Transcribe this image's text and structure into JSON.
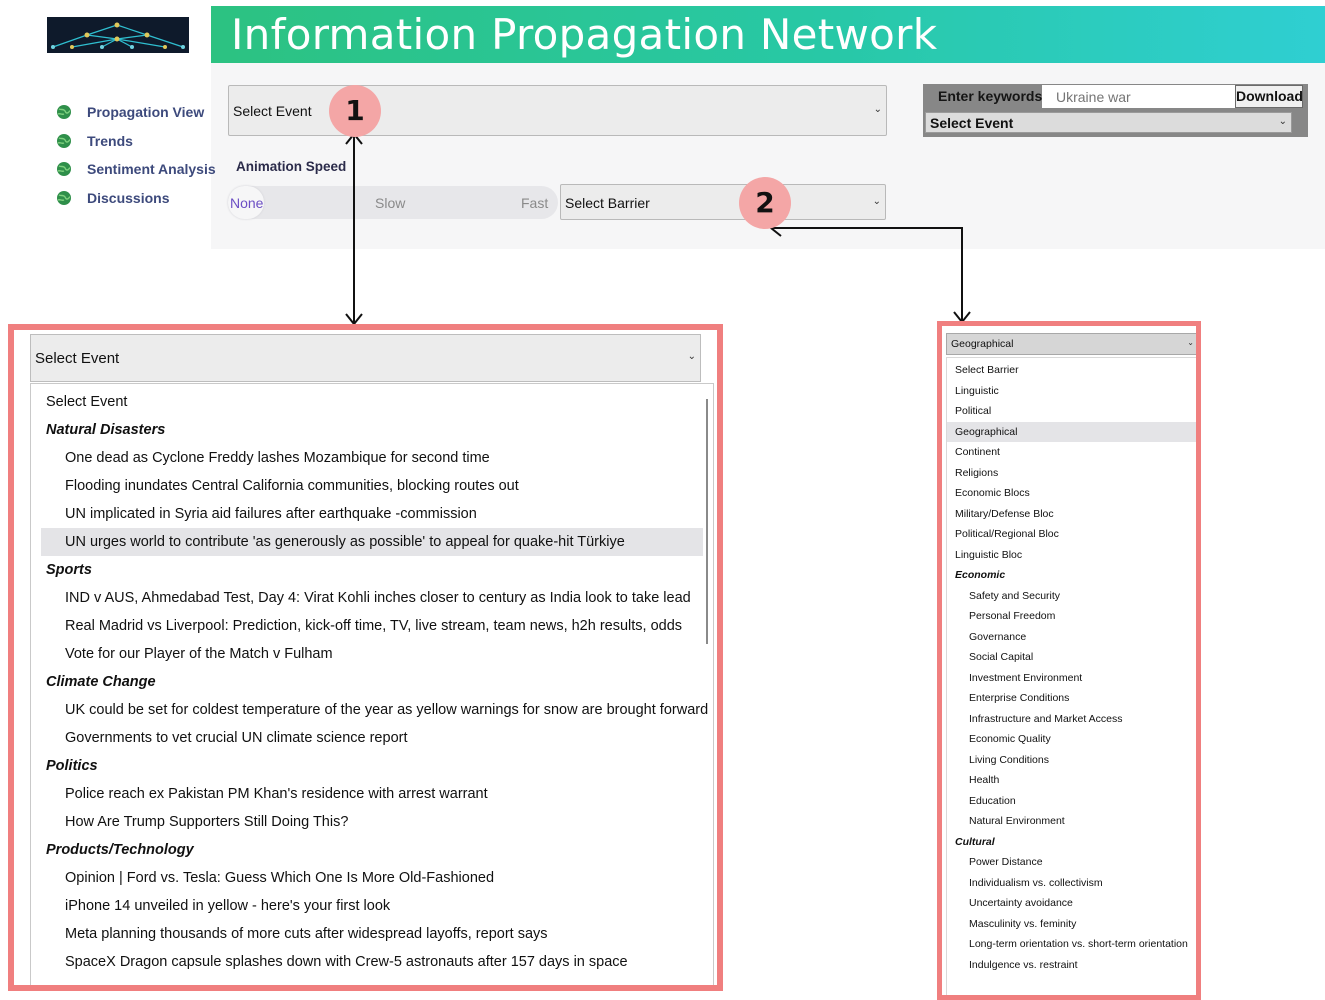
{
  "app": {
    "title": "Information Propagation Network",
    "brand_color": "#2cc281"
  },
  "sidebar": {
    "items": [
      {
        "label": "Propagation View",
        "icon": "globe-icon"
      },
      {
        "label": "Trends",
        "icon": "globe-icon"
      },
      {
        "label": "Sentiment Analysis",
        "icon": "globe-icon"
      },
      {
        "label": "Discussions",
        "icon": "globe-icon"
      }
    ]
  },
  "controls": {
    "event_select": {
      "value": "Select Event"
    },
    "animation_speed": {
      "label": "Animation Speed",
      "options": [
        "None",
        "Slow",
        "Fast"
      ],
      "selected": "None"
    },
    "barrier_select": {
      "value": "Select Barrier"
    }
  },
  "keywords_panel": {
    "label": "Enter keywords:",
    "input_placeholder": "Ukraine war",
    "download_label": "Download",
    "event_select_value": "Select Event"
  },
  "callouts": {
    "one": "1",
    "two": "2",
    "color": "#f4a6a6",
    "border_color": "#f07f7f"
  },
  "event_dropdown": {
    "selected": "Select Event",
    "default_option": "Select Event",
    "groups": [
      {
        "name": "Natural Disasters",
        "items": [
          "One dead as Cyclone Freddy lashes Mozambique for second time",
          "Flooding inundates Central California communities, blocking routes out",
          "UN implicated in Syria aid failures after earthquake -commission",
          "UN urges world to contribute 'as generously as possible' to appeal for quake-hit Türkiye"
        ]
      },
      {
        "name": "Sports",
        "items": [
          "IND v AUS, Ahmedabad Test, Day 4: Virat Kohli inches closer to century as India look to take lead",
          "Real Madrid vs Liverpool: Prediction, kick-off time, TV, live stream, team news, h2h results, odds",
          "Vote for our Player of the Match v Fulham"
        ]
      },
      {
        "name": "Climate Change",
        "items": [
          "UK could be set for coldest temperature of the year as yellow warnings for snow are brought forward",
          "Governments to vet crucial UN climate science report"
        ]
      },
      {
        "name": "Politics",
        "items": [
          "Police reach ex Pakistan PM Khan's residence with arrest warrant",
          "How Are Trump Supporters Still Doing This?"
        ]
      },
      {
        "name": "Products/Technology",
        "items": [
          "Opinion | Ford vs. Tesla: Guess Which One Is More Old-Fashioned",
          "iPhone 14 unveiled in yellow - here's your first look",
          "Meta planning thousands of more cuts after widespread layoffs, report says",
          "SpaceX Dragon capsule splashes down with Crew-5 astronauts after 157 days in space"
        ]
      }
    ],
    "highlighted": "UN urges world to contribute 'as generously as possible' to appeal for quake-hit Türkiye"
  },
  "barrier_dropdown": {
    "selected": "Geographical",
    "top_options": [
      "Select Barrier",
      "Linguistic",
      "Political",
      "Geographical",
      "Continent",
      "Religions",
      "Economic Blocs",
      "Military/Defense Bloc",
      "Political/Regional Bloc",
      "Linguistic Bloc"
    ],
    "highlighted": "Geographical",
    "groups": [
      {
        "name": "Economic",
        "items": [
          "Safety and Security",
          "Personal Freedom",
          "Governance",
          "Social Capital",
          "Investment Environment",
          "Enterprise Conditions",
          "Infrastructure and Market Access",
          "Economic Quality",
          "Living Conditions",
          "Health",
          "Education",
          "Natural Environment"
        ]
      },
      {
        "name": "Cultural",
        "items": [
          "Power Distance",
          "Individualism vs. collectivism",
          "Uncertainty avoidance",
          "Masculinity vs. feminity",
          "Long-term orientation vs. short-term orientation",
          "Indulgence vs. restraint"
        ]
      }
    ]
  }
}
